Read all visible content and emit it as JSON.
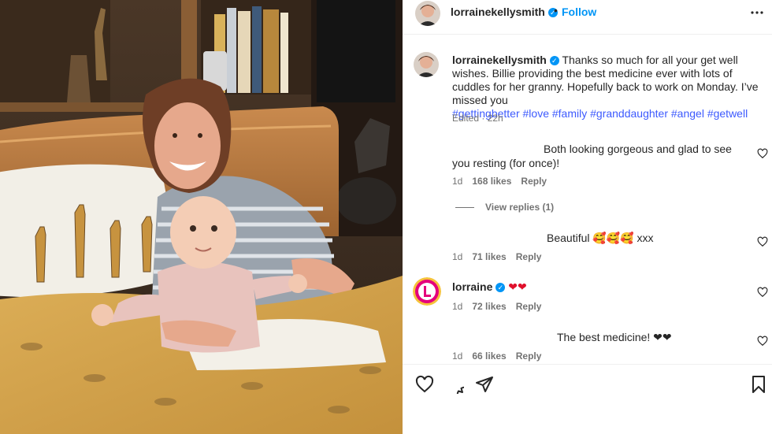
{
  "post": {
    "username": "lorrainekellysmith",
    "follow_label": "Follow",
    "dot": "•",
    "caption_text": "Thanks so much for all your get well wishes. Billie providing the best medicine ever with lots of cuddles for her granny. Hopefully back to work on Monday. I’ve missed you",
    "hashtags": [
      "#gettingbetter",
      "#love",
      "#family",
      "#granddaughter",
      "#angel",
      "#getwell"
    ],
    "edited": "Edited · 22h"
  },
  "comments": [
    {
      "text": "Both looking gorgeous and glad to see you resting (for once)!",
      "age": "1d",
      "likes": "168 likes",
      "reply": "Reply"
    },
    {
      "text": "Beautiful 🥰🥰🥰 xxx",
      "age": "1d",
      "likes": "71 likes",
      "reply": "Reply"
    },
    {
      "username": "lorraine",
      "text": "❤❤",
      "age": "1d",
      "likes": "72 likes",
      "reply": "Reply"
    },
    {
      "text": "The best medicine! ❤❤",
      "age": "1d",
      "likes": "66 likes",
      "reply": "Reply"
    }
  ],
  "view_replies": "View replies (1)",
  "icons": {
    "header": [
      "more-icon"
    ],
    "actions": [
      "heart-icon",
      "comment-icon",
      "share-icon",
      "bookmark-icon"
    ]
  },
  "colors": {
    "accent": "#0095f6",
    "text": "#262626",
    "muted": "#737373",
    "hashtag": "#3d5afe",
    "heart": "#e0102b"
  }
}
